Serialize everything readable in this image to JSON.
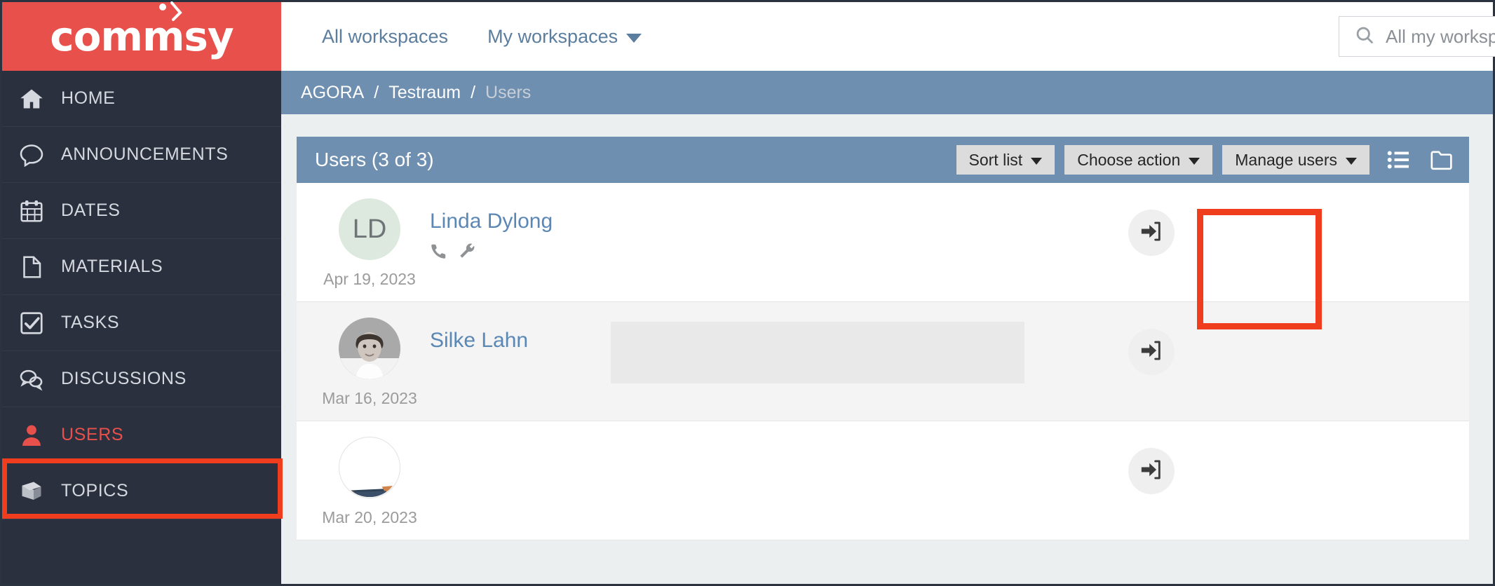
{
  "brand": {
    "name": "commsy",
    "bg_color": "#e8504b"
  },
  "sidebar": {
    "bg_color": "#2b303f",
    "active_color": "#e8504b",
    "items": [
      {
        "label": "HOME",
        "icon": "home-icon"
      },
      {
        "label": "ANNOUNCEMENTS",
        "icon": "speech-bubble-icon"
      },
      {
        "label": "DATES",
        "icon": "calendar-icon"
      },
      {
        "label": "MATERIALS",
        "icon": "document-icon"
      },
      {
        "label": "TASKS",
        "icon": "checkbox-icon"
      },
      {
        "label": "DISCUSSIONS",
        "icon": "discussions-icon"
      },
      {
        "label": "USERS",
        "icon": "user-icon"
      },
      {
        "label": "TOPICS",
        "icon": "book-icon"
      }
    ]
  },
  "topbar": {
    "links": [
      {
        "label": "All workspaces",
        "has_caret": false
      },
      {
        "label": "My workspaces",
        "has_caret": true
      }
    ],
    "search": {
      "placeholder": "All my workspaces",
      "icon": "search-icon"
    }
  },
  "breadcrumb": {
    "items": [
      {
        "label": "AGORA",
        "current": false
      },
      {
        "label": "Testraum",
        "current": false
      },
      {
        "label": "Users",
        "current": true
      }
    ],
    "separator": "/"
  },
  "panel": {
    "title": "Users (3 of 3)",
    "header_color": "#6e8fb0",
    "buttons": [
      {
        "label": "Sort list",
        "caret": true
      },
      {
        "label": "Choose action",
        "caret": true
      },
      {
        "label": "Manage users",
        "caret": true
      }
    ],
    "view_icons": [
      {
        "name": "list-view-icon"
      },
      {
        "name": "folder-view-icon"
      }
    ]
  },
  "users": [
    {
      "name": "Linda Dylong",
      "initials": "LD",
      "date": "Apr 19, 2023",
      "avatar_type": "initials",
      "flag_color": "#d4883c",
      "icons": [
        "phone-icon",
        "wrench-icon"
      ],
      "redacted": false,
      "action_icon": "sign-in-icon"
    },
    {
      "name": "Silke Lahn",
      "initials": "",
      "date": "Mar 16, 2023",
      "avatar_type": "photo",
      "flag_color": "#cc4b2e",
      "icons": [],
      "redacted": true,
      "action_icon": "sign-in-icon"
    },
    {
      "name": "",
      "initials": "",
      "date": "Mar 20, 2023",
      "avatar_type": "blank",
      "flag_color": "#cc4b2e",
      "icons": [],
      "redacted": false,
      "action_icon": "sign-in-icon"
    }
  ],
  "annotations": [
    {
      "name": "users-nav-highlight",
      "color": "#ef3d1e"
    },
    {
      "name": "enter-room-button-highlight",
      "color": "#ef3d1e"
    }
  ]
}
